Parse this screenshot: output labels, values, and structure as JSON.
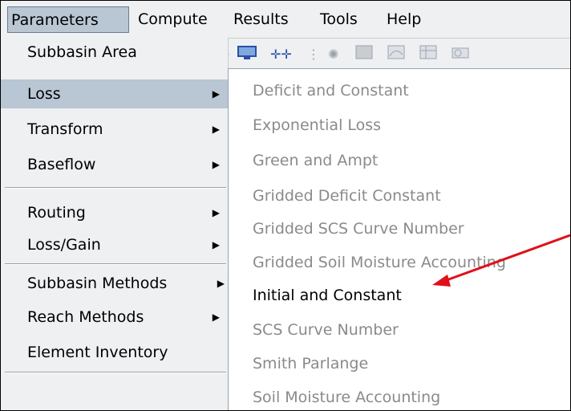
{
  "menubar": {
    "items": [
      "Parameters",
      "Compute",
      "Results",
      "Tools",
      "Help"
    ]
  },
  "toolbar": {
    "icons": [
      "arrow-icon",
      "monitor-icon",
      "plus-icon",
      "grip-icon",
      "grid-icon",
      "table-icon",
      "chart-icon",
      "spreadsheet-icon",
      "clock-icon"
    ]
  },
  "parameters_menu": {
    "items": [
      {
        "label": "Subbasin Area",
        "submenu": false
      },
      {
        "label": "Loss",
        "submenu": true,
        "highlighted": true
      },
      {
        "label": "Transform",
        "submenu": true
      },
      {
        "label": "Baseflow",
        "submenu": true
      },
      {
        "label": "Routing",
        "submenu": true
      },
      {
        "label": "Loss/Gain",
        "submenu": true
      },
      {
        "label": "Subbasin Methods",
        "submenu": true
      },
      {
        "label": "Reach Methods",
        "submenu": true
      },
      {
        "label": "Element Inventory",
        "submenu": false
      }
    ]
  },
  "loss_submenu": {
    "items": [
      {
        "label": "Deficit and Constant",
        "enabled": false
      },
      {
        "label": "Exponential Loss",
        "enabled": false
      },
      {
        "label": "Green and Ampt",
        "enabled": false
      },
      {
        "label": "Gridded Deficit Constant",
        "enabled": false
      },
      {
        "label": "Gridded SCS Curve Number",
        "enabled": false
      },
      {
        "label": "Gridded Soil Moisture Accounting",
        "enabled": false
      },
      {
        "label": "Initial and Constant",
        "enabled": true
      },
      {
        "label": "SCS Curve Number",
        "enabled": false
      },
      {
        "label": "Smith Parlange",
        "enabled": false
      },
      {
        "label": "Soil Moisture Accounting",
        "enabled": false
      }
    ]
  },
  "colors": {
    "menu_bg": "#eef0f2",
    "highlight": "#b9c6d3",
    "disabled_text": "#8a8a8a",
    "annotation_arrow": "#e0101a"
  }
}
